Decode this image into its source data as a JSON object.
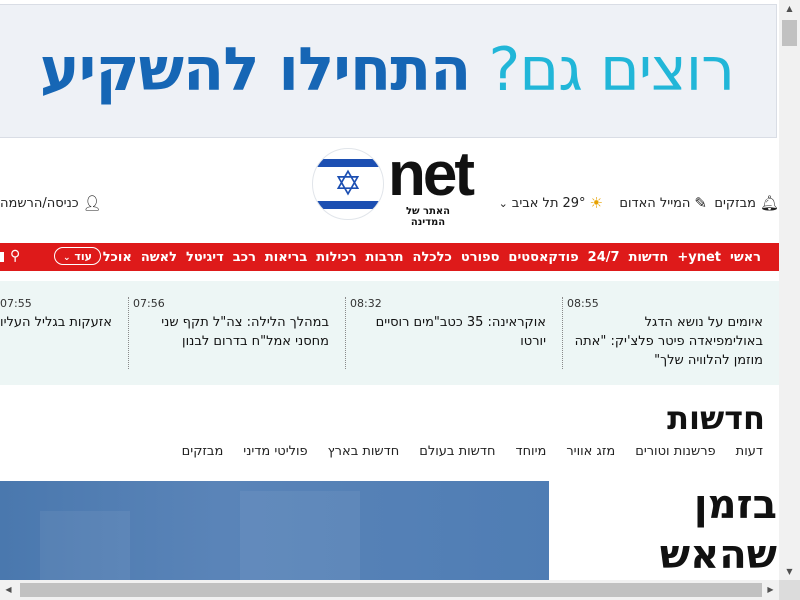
{
  "banner": {
    "text_light": "רוצים גם?",
    "text_bold": "התחילו להשקיע",
    "colors": {
      "light": "#21b6d8",
      "bold": "#1666b5",
      "background": "#eef1f6"
    }
  },
  "header": {
    "logo_text": "net",
    "logo_tagline": "האתר של המדינה",
    "alerts_label": "מבזקים",
    "alerts_icon": "bell-icon",
    "red_mail_label": "המייל האדום",
    "red_mail_icon": "edit-icon",
    "weather_city": "תל אביב",
    "weather_temp": "29°",
    "weather_icon": "sun-icon",
    "login_label": "כניסה/הרשמה",
    "login_icon": "user-icon"
  },
  "nav": {
    "color": "#de1a1a",
    "items": [
      "ראשי",
      "ynet+",
      "חדשות",
      "24/7",
      "פודקאסטים",
      "ספורט",
      "כלכלה",
      "תרבות",
      "רכילות",
      "בריאות",
      "רכב",
      "דיגיטל",
      "לאשה",
      "אוכל"
    ],
    "more_label": "עוד",
    "search_icon": "search-icon"
  },
  "ticker": [
    {
      "time": "08:55",
      "text": "איומים על נושא הדגל באולימפיאדה פיטר פלצ'יק: \"אתה מוזמן להלוויה שלך\""
    },
    {
      "time": "08:32",
      "text": "אוקראינה: 35 כטב\"מים רוסיים יורטו"
    },
    {
      "time": "07:56",
      "text": "במהלך הלילה: צה\"ל תקף שני מחסני אמל\"ח בדרום לבנון"
    },
    {
      "time": "07:55",
      "text": "אזעקות בגליל העליון"
    }
  ],
  "section": {
    "title": "חדשות",
    "subnav": [
      "מבזקים",
      "פוליטי מדיני",
      "חדשות בארץ",
      "חדשות בעולם",
      "מיוחד",
      "מזג אוויר",
      "פרשנות וטורים",
      "דעות"
    ],
    "hero_title": "בזמן שהאש"
  }
}
